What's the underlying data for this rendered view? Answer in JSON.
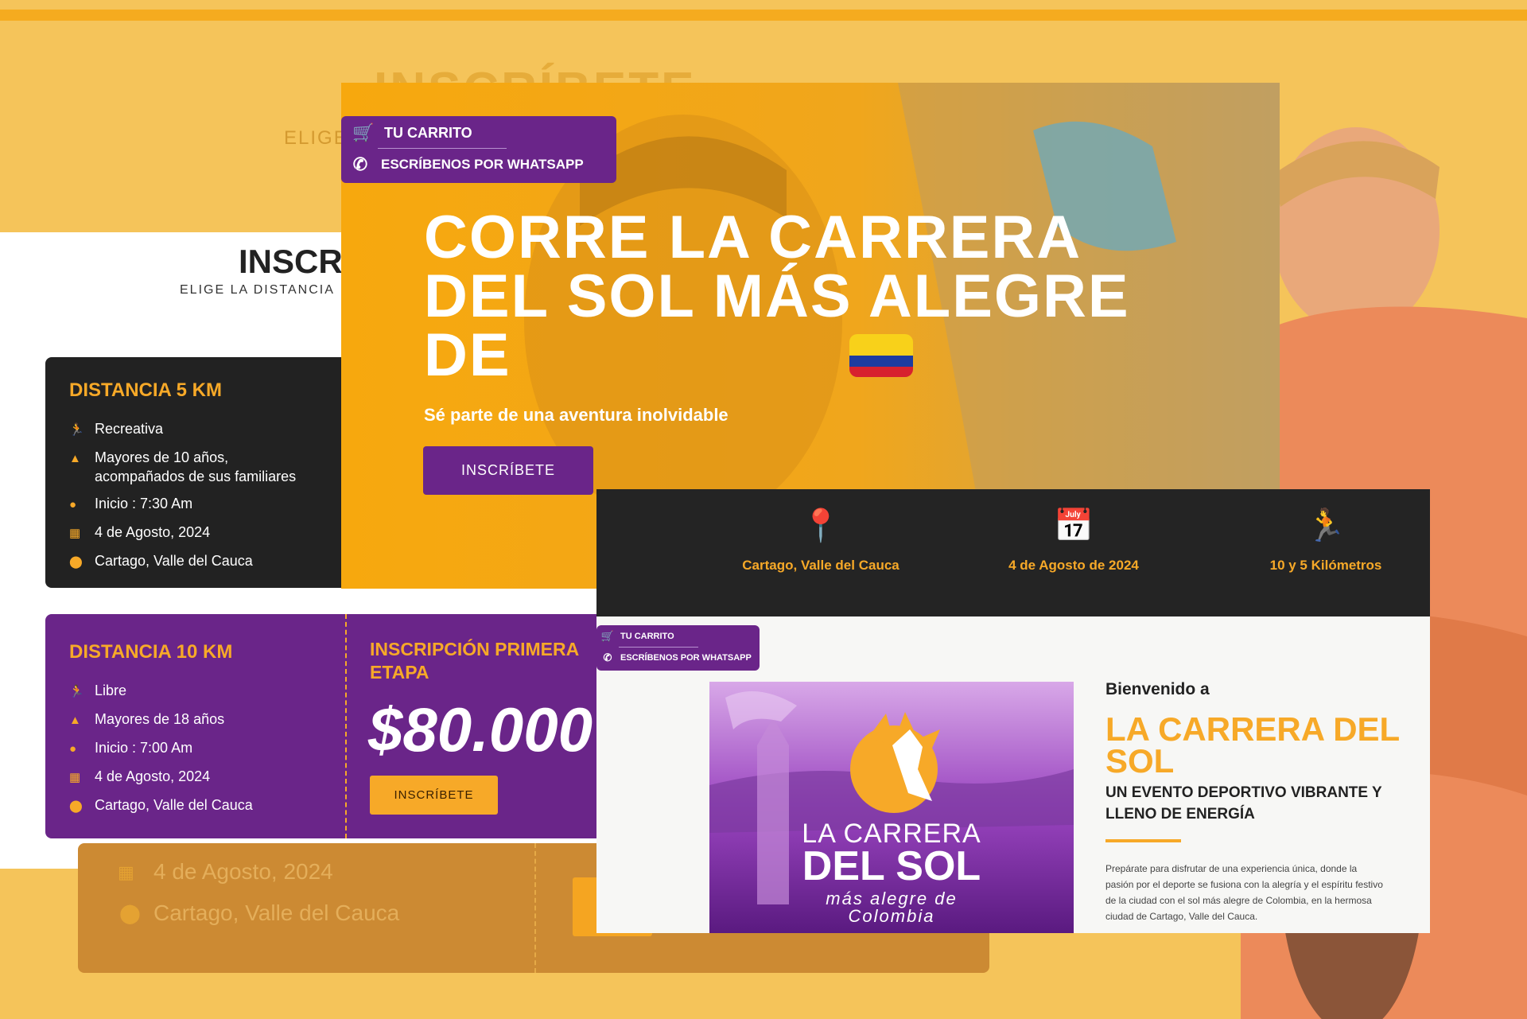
{
  "background": {
    "title": "INSCRÍBETE",
    "subtitle": "ELIGE",
    "echo_date": "4 de Agosto, 2024",
    "echo_place": "Cartago, Valle del Cauca"
  },
  "registration": {
    "title": "INSCRÍBETE",
    "subtitle": "ELIGE LA DISTANCIA",
    "card_5k": {
      "title": "DISTANCIA 5 KM",
      "items": [
        {
          "icon": "runner-icon",
          "text": "Recreativa"
        },
        {
          "icon": "warning-icon",
          "text": "Mayores de 10 años,\nacompañados de sus familiares"
        },
        {
          "icon": "clock-icon",
          "text": "Inicio : 7:30 Am"
        },
        {
          "icon": "calendar-icon",
          "text": "4 de Agosto, 2024"
        },
        {
          "icon": "pin-icon",
          "text": "Cartago, Valle del Cauca"
        }
      ]
    },
    "card_10k": {
      "title": "DISTANCIA 10 KM",
      "items": [
        {
          "icon": "runner-icon",
          "text": "Libre"
        },
        {
          "icon": "warning-icon",
          "text": "Mayores de 18 años"
        },
        {
          "icon": "clock-icon",
          "text": "Inicio : 7:00 Am"
        },
        {
          "icon": "calendar-icon",
          "text": "4 de Agosto, 2024"
        },
        {
          "icon": "pin-icon",
          "text": "Cartago, Valle del Cauca"
        }
      ],
      "price_heading": "INSCRIPCIÓN PRIMERA ETAPA",
      "price": "$80.000",
      "button": "INSCRÍBETE"
    }
  },
  "hero": {
    "menu": {
      "cart": "TU CARRITO",
      "whatsapp": "ESCRÍBENOS POR WHATSAPP"
    },
    "headline": "CORRE LA CARRERA DEL SOL MÁS ALEGRE DE",
    "subheadline": "Sé parte de una aventura inolvidable",
    "button": "INSCRÍBETE"
  },
  "infobar": {
    "items": [
      {
        "icon": "pin-icon",
        "label": "Cartago, Valle del Cauca"
      },
      {
        "icon": "calendar-check-icon",
        "label": "4 de Agosto de 2024"
      },
      {
        "icon": "runner-icon",
        "label": "10 y 5 Kilómetros"
      }
    ]
  },
  "welcome": {
    "menu": {
      "cart": "TU CARRITO",
      "whatsapp": "ESCRÍBENOS POR WHATSAPP"
    },
    "logo": {
      "line1": "LA CARRERA",
      "line2": "DEL SOL",
      "line3": "más alegre de",
      "line4": "Colombia"
    },
    "kicker": "Bienvenido a",
    "title": "LA CARRERA DEL SOL",
    "tagline": "UN EVENTO DEPORTIVO VIBRANTE Y LLENO DE ENERGÍA",
    "body": "Prepárate para disfrutar de una experiencia única, donde la pasión por el deporte se fusiona con la alegría y el espíritu festivo de la ciudad con el sol más alegre de Colombia, en la hermosa ciudad de Cartago, Valle del Cauca."
  },
  "colors": {
    "accent": "#f7a928",
    "purple": "#6a2589",
    "dark": "#222222",
    "background": "#f5c45a"
  }
}
